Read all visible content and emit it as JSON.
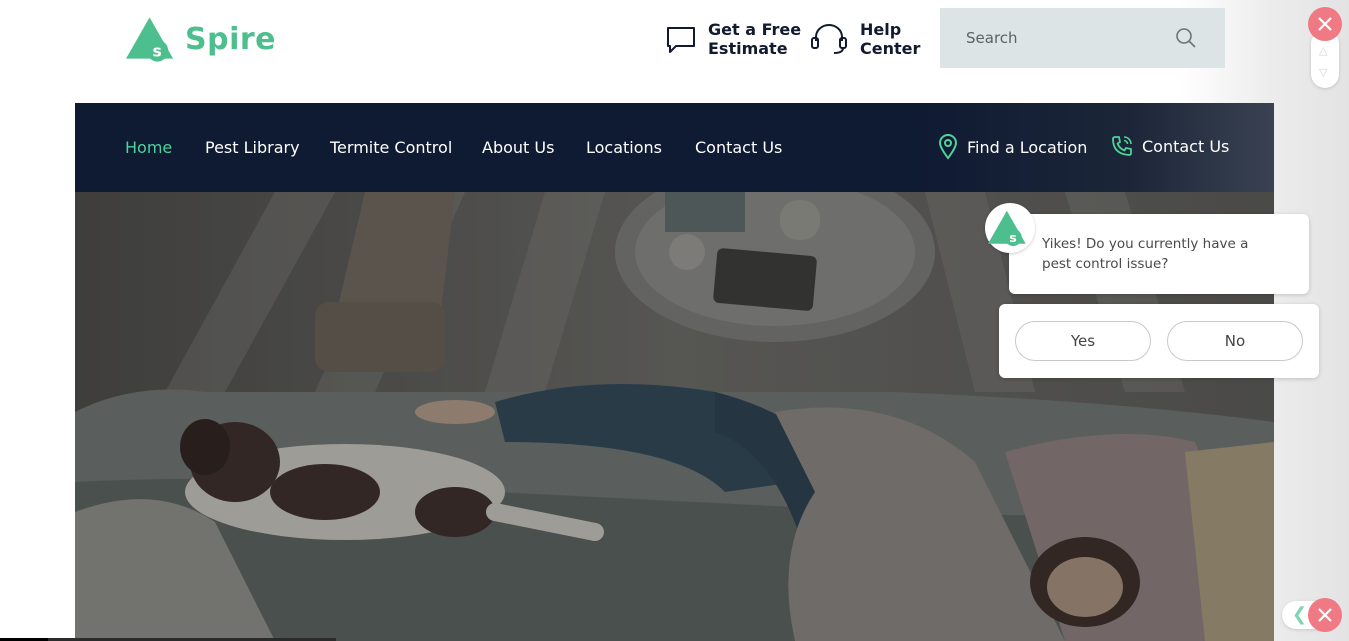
{
  "brand": {
    "name": "Spire",
    "mark_letter": "s",
    "color": "#4dbf8e"
  },
  "header": {
    "estimate": {
      "line1": "Get a Free",
      "line2": "Estimate",
      "icon": "chat-bubble-icon"
    },
    "help": {
      "line1": "Help",
      "line2": "Center",
      "icon": "headset-icon"
    },
    "search": {
      "placeholder": "Search",
      "value": "",
      "icon": "search-icon"
    }
  },
  "nav": {
    "items": [
      {
        "label": "Home",
        "active": true
      },
      {
        "label": "Pest Library",
        "active": false
      },
      {
        "label": "Termite Control",
        "active": false
      },
      {
        "label": "About Us",
        "active": false
      },
      {
        "label": "Locations",
        "active": false
      },
      {
        "label": "Contact Us",
        "active": false
      }
    ],
    "find_location": {
      "label": "Find a Location",
      "icon": "map-pin-icon"
    },
    "contact": {
      "label": "Contact Us",
      "icon": "phone-icon"
    },
    "accent": "#4fd39a",
    "background": "#0f1a33"
  },
  "chat": {
    "message": "Yikes! Do you currently have a pest control issue?",
    "options": {
      "yes": "Yes",
      "no": "No"
    },
    "close_color": "#f07a84"
  }
}
